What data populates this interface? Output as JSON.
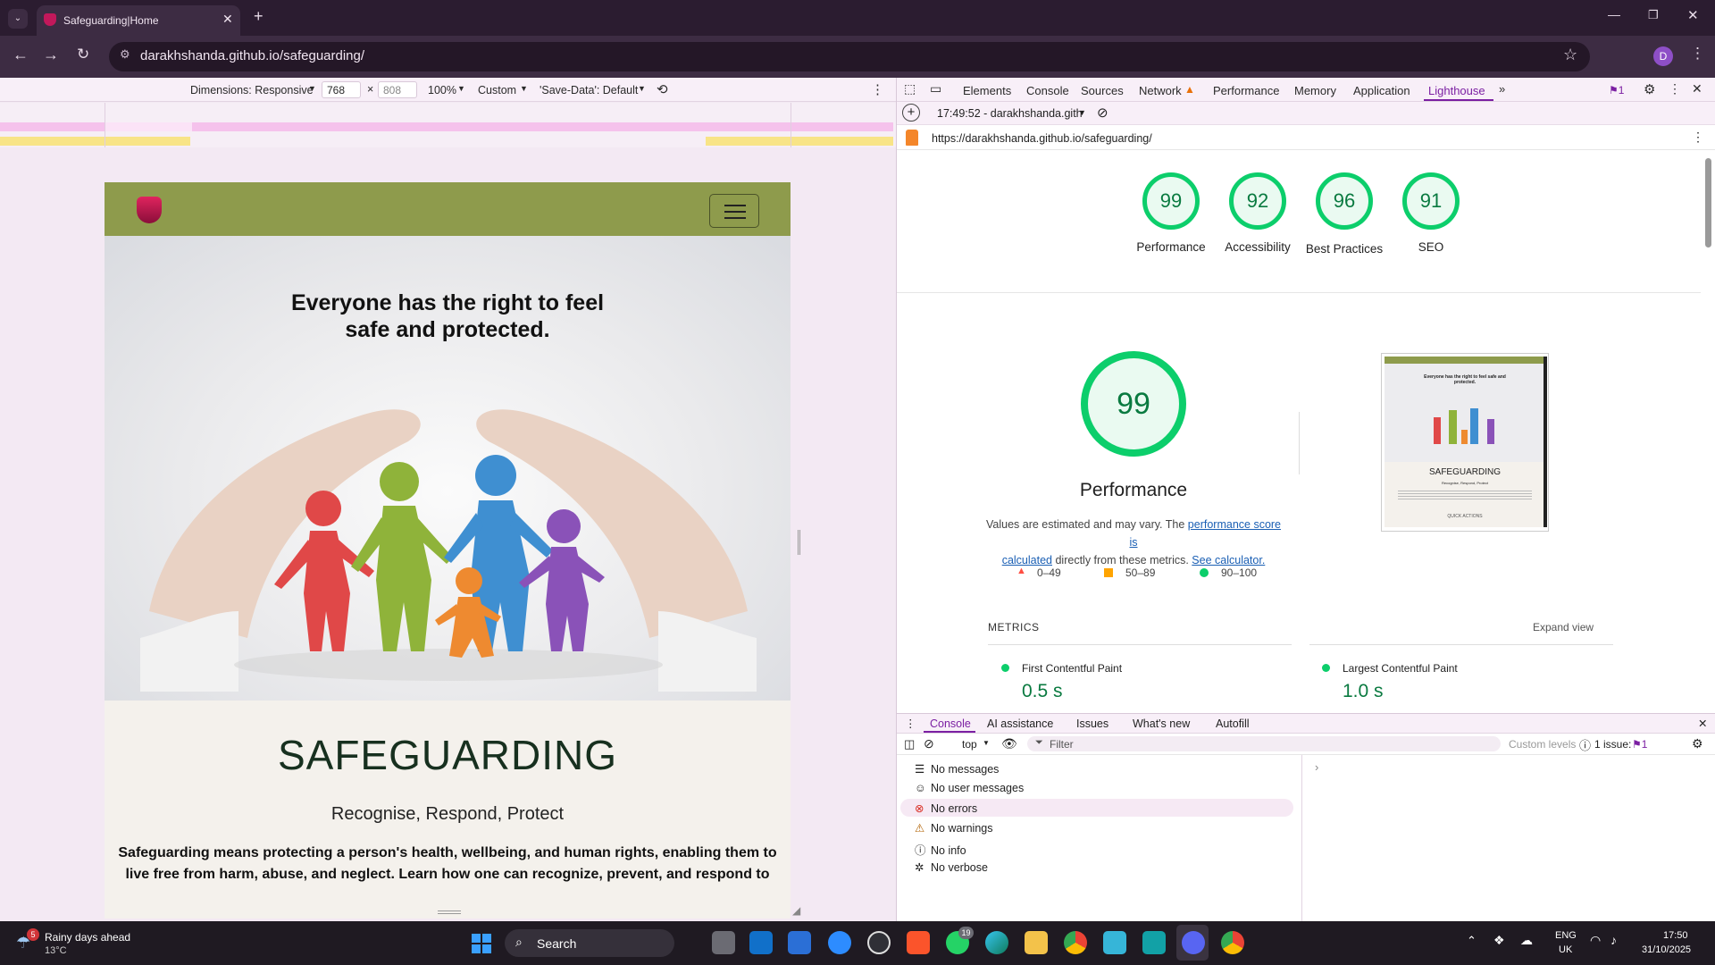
{
  "browser": {
    "tab_title": "Safeguarding|Home",
    "url": "darakhshanda.github.io/safeguarding/",
    "profile_initial": "D"
  },
  "device_toolbar": {
    "dimensions_label": "Dimensions: Responsive",
    "width": "768",
    "height": "808",
    "zoom": "100%",
    "throttle": "Custom",
    "save_data": "'Save-Data': Default"
  },
  "page": {
    "headline_line1": "Everyone has the right to feel",
    "headline_line2": "safe and protected.",
    "title": "SAFEGUARDING",
    "subtitle": "Recognise, Respond, Protect",
    "body_line1": "Safeguarding means protecting a person's health, wellbeing, and human rights, enabling them to",
    "body_line2": "live free from harm, abuse, and neglect. Learn how one can recognize, prevent, and respond to"
  },
  "devtools": {
    "tabs": [
      "Elements",
      "Console",
      "Sources",
      "Network",
      "Performance",
      "Memory",
      "Application",
      "Lighthouse"
    ],
    "active_tab": "Lighthouse",
    "issues_badge": "1"
  },
  "lighthouse": {
    "report_time": "17:49:52 - darakhshanda.gith",
    "audited_url": "https://darakhshanda.github.io/safeguarding/",
    "scores": [
      {
        "value": "99",
        "label": "Performance"
      },
      {
        "value": "92",
        "label": "Accessibility"
      },
      {
        "value": "96",
        "label": "Best Practices"
      },
      {
        "value": "91",
        "label": "SEO"
      }
    ],
    "main_score": "99",
    "main_label": "Performance",
    "note_pre": "Values are estimated and may vary. The ",
    "note_link1": "performance score is",
    "note_link1b": "calculated",
    "note_mid": " directly from these metrics. ",
    "note_link2": "See calculator.",
    "legend": [
      {
        "range": "0–49",
        "color": "#ff4e42"
      },
      {
        "range": "50–89",
        "color": "#ffa400"
      },
      {
        "range": "90–100",
        "color": "#0cce6b"
      }
    ],
    "metrics_label": "METRICS",
    "expand_label": "Expand view",
    "metrics": [
      {
        "name": "First Contentful Paint",
        "value": "0.5 s"
      },
      {
        "name": "Largest Contentful Paint",
        "value": "1.0 s"
      }
    ],
    "thumb": {
      "headline": "Everyone has the right to feel safe and protected.",
      "title": "SAFEGUARDING",
      "subtitle": "Recognise, Respond, Protect",
      "footer": "QUICK ACTIONS"
    }
  },
  "console": {
    "tabs": [
      "Console",
      "AI assistance",
      "Issues",
      "What's new",
      "Autofill"
    ],
    "context": "top",
    "filter_placeholder": "Filter",
    "levels": "Custom levels",
    "issues": "1 issue:",
    "issues_count": "1",
    "messages": [
      "No messages",
      "No user messages",
      "No errors",
      "No warnings",
      "No info",
      "No verbose"
    ]
  },
  "taskbar": {
    "weather_title": "Rainy days ahead",
    "weather_temp": "13°C",
    "weather_badge": "5",
    "search": "Search",
    "whatsapp_badge": "19",
    "lang1": "ENG",
    "lang2": "UK",
    "time": "17:50",
    "date": "31/10/2025"
  }
}
